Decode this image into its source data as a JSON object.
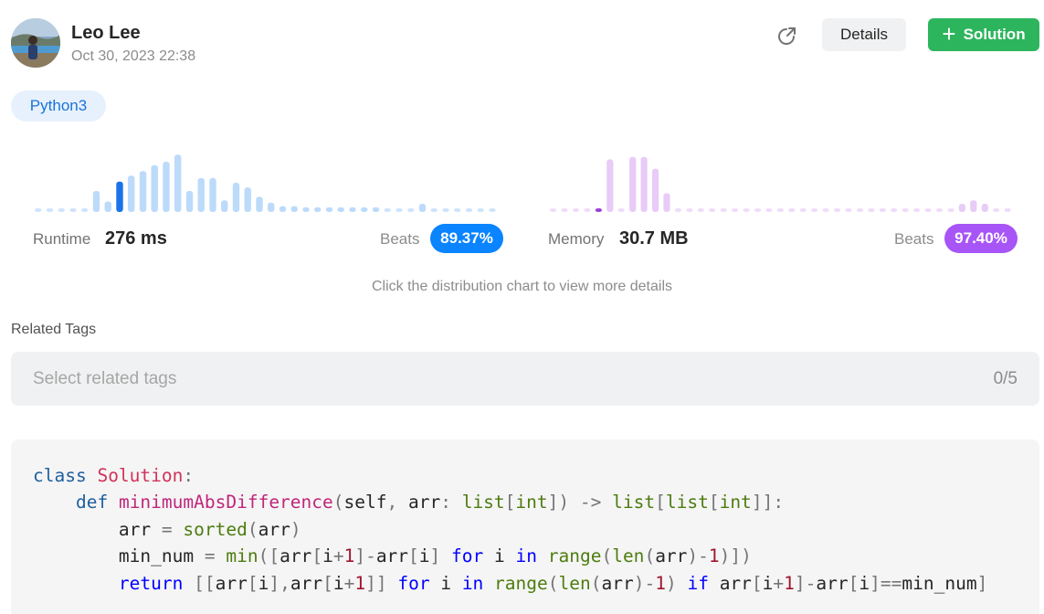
{
  "user": {
    "name": "Leo Lee",
    "date": "Oct 30, 2023 22:38"
  },
  "actions": {
    "details_label": "Details",
    "solution_label": "Solution",
    "share_icon": "share-icon",
    "plus_icon": "plus-icon"
  },
  "language": "Python3",
  "runtime": {
    "label": "Runtime",
    "value": "276 ms",
    "beats_label": "Beats",
    "beats_value": "89.37%",
    "accent": "#0a84ff",
    "bar_color": "#bcdbfa",
    "dot_color": "#cfe4fb",
    "highlight_color": "#1a73e8"
  },
  "memory": {
    "label": "Memory",
    "value": "30.7 MB",
    "beats_label": "Beats",
    "beats_value": "97.40%",
    "accent": "#a855f7",
    "bar_color": "#e9cbf7",
    "dot_color": "#f0dcf9",
    "highlight_color": "#9c3fd8"
  },
  "chart_data": [
    {
      "type": "bar",
      "name_key": "runtime",
      "values": [
        0.06,
        0.06,
        0.06,
        0.06,
        0.06,
        0.36,
        0.18,
        0.52,
        0.62,
        0.7,
        0.8,
        0.86,
        0.98,
        0.36,
        0.58,
        0.58,
        0.2,
        0.5,
        0.42,
        0.26,
        0.16,
        0.1,
        0.1,
        0.08,
        0.08,
        0.08,
        0.08,
        0.08,
        0.08,
        0.08,
        0.06,
        0.06,
        0.06,
        0.14,
        0.06,
        0.06,
        0.06,
        0.06,
        0.06,
        0.06
      ],
      "highlight_index": 7
    },
    {
      "type": "bar",
      "name_key": "memory",
      "values": [
        0.06,
        0.06,
        0.06,
        0.06,
        0.06,
        0.9,
        0.06,
        0.94,
        0.94,
        0.74,
        0.32,
        0.06,
        0.06,
        0.06,
        0.06,
        0.06,
        0.06,
        0.06,
        0.06,
        0.06,
        0.06,
        0.06,
        0.06,
        0.06,
        0.06,
        0.06,
        0.06,
        0.06,
        0.06,
        0.06,
        0.06,
        0.06,
        0.06,
        0.06,
        0.06,
        0.06,
        0.14,
        0.2,
        0.14,
        0.06,
        0.06
      ],
      "highlight_index": 4
    }
  ],
  "distribution_hint": "Click the distribution chart to view more details",
  "tags": {
    "title": "Related Tags",
    "placeholder": "Select related tags",
    "count": "0/5"
  },
  "code": {
    "language": "python",
    "lines": [
      "class Solution:",
      "    def minimumAbsDifference(self, arr: list[int]) -> list[list[int]]:",
      "        arr = sorted(arr)",
      "        min_num = min([arr[i+1]-arr[i] for i in range(len(arr)-1)])",
      "        return [[arr[i],arr[i+1]] for i in range(len(arr)-1) if arr[i+1]-arr[i]==min_num]"
    ]
  }
}
